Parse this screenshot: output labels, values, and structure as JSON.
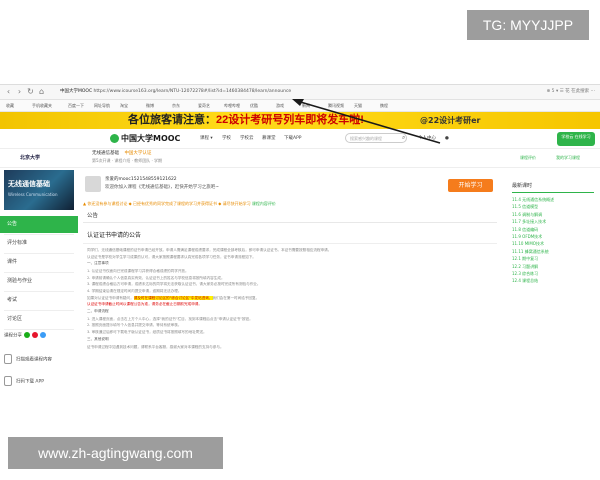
{
  "overlay": {
    "tg_label": "TG: MYYJJPP",
    "site_label": "www.zh-agtingwang.com"
  },
  "browser": {
    "back": "‹",
    "forward": "›",
    "reload": "↻",
    "home": "⌂",
    "url_host": "中国大学MOOC",
    "url": "https://www.icourse163.org/learn/NTU-12072278#/list?id=1460384478/learn/announce",
    "right_tools": "⊕ 5 ▾  ☰ 花  在此搜索  ⋯",
    "bookmarks": [
      "收藏",
      "手机收藏夹",
      "百度一下",
      "网址导航",
      "淘宝",
      "微博",
      "京东",
      "爱奇艺",
      "哔哩哔哩",
      "优酷",
      "游戏",
      "新闻",
      "腾讯视频",
      "天猫",
      "携程"
    ]
  },
  "banner": {
    "prefix": "各位旅客请注意：",
    "highlight": "22设计考研号列车即将发车啦!",
    "right": "@22设计考研er"
  },
  "mooc_header": {
    "logo": "中国大学MOOC",
    "nav": [
      "课程 ▾",
      "学校",
      "学校云",
      "慕课堂",
      "下载APP"
    ],
    "search_placeholder": "搜索感兴趣的课程",
    "search_icon": "search-icon",
    "personal": "个人中心",
    "green_button": "学校云 在线学习"
  },
  "course_header": {
    "school": "北京大学",
    "course_name": "无线通信基础",
    "tag": "中国大学认证",
    "course_sub": "第5次开课  · 课程介绍  · 教师团队  · 学期",
    "right_links": [
      "课程评价",
      "我的学习课程"
    ]
  },
  "sidebar": {
    "thumb_title": "无线通信基础",
    "thumb_sub": "Wireless Communication",
    "items": [
      "公告",
      "评分标准",
      "课件",
      "测验与作业",
      "考试",
      "讨论区"
    ],
    "active_index": 0,
    "share_label": "课程分享",
    "share_colors": [
      "#1aad19",
      "#e6162d",
      "#3b9cf6"
    ],
    "apps": [
      "扫描观看课程内容",
      "扫码下载 APP"
    ]
  },
  "content": {
    "welcome_line1": "亲爱的mooc1521548559121622",
    "welcome_line2": "欢迎你加入课程《无线通信基础》，赶快开始学习之旅吧~",
    "start_button": "开始学习",
    "tips": "▲ 你还没有参与课程讨论  ◆ 已经有优秀的同学完成了课程的学习并获得证书  ◆ 请尽快开始学习  ",
    "tips_ok": "课程内容评价",
    "section_label": "公告",
    "announcement_title": "认证证书申请的公告",
    "paragraphs": [
      {
        "text": "同学们，无线通信基础课程的证书申请已经开放。申请人需满足课程成绩要求，完成课程全部考核后，即可申请认证证书。",
        "tail": "本证书需要按照相应流程申请。",
        "style": "normal"
      },
      {
        "text": "认证证书是学校对学生学习成果的认可，请大家按照课程要求认真完成各项学习任务，证书申请流程如下。",
        "tail": "",
        "style": "normal"
      },
      {
        "text": "一、注意事项",
        "tail": "",
        "style": "dark"
      },
      {
        "text": "1. 认证证书仅面向已完成课程学习并获得合格成绩的同学开放。",
        "tail": "",
        "style": "normal"
      },
      {
        "text": "2. 申请前请确认个人信息真实有效，认证证书上的姓名与学校信息将按所填内容生成。",
        "tail": "",
        "style": "normal"
      },
      {
        "text": "3. 课程成绩合格后方可申请，成绩未达标的同学将无法获取认证证书，请大家务必按时完成所有测验与作业。",
        "tail": "",
        "style": "normal"
      },
      {
        "text": "4. 学期结束后请在规定时间内提交申请，逾期将无法办理。",
        "tail": "",
        "style": "normal"
      },
      {
        "text": "如果对认证证书申请有疑问，",
        "hl": "请及时在课程讨论区的\"综合讨论区\"中发帖咨询，",
        "tail": "我们会在第一时间给予回复。",
        "style": "normal"
      },
      {
        "text": "",
        "red": "认证证书申请截止时间以课程公告为准，请务必在截止日期前完成申请。",
        "tail": "",
        "style": "normal"
      },
      {
        "text": "二、申请流程",
        "tail": "",
        "style": "dark"
      },
      {
        "text": "1. 进入课程页面，点击右上方个人中心，选择\"我的证书\"栏目，找到本课程后点击\"申请认证证书\"按钮。",
        "tail": "",
        "style": "normal"
      },
      {
        "text": "2. 按照页面提示填写个人信息并提交申请，等待系统审核。",
        "tail": "",
        "style": "normal"
      },
      {
        "text": "3. 审核通过后即可下载电子版认证证书，纸质证书将按照填写的地址寄送。",
        "tail": "",
        "style": "normal"
      },
      {
        "text": "三、其他说明",
        "tail": "",
        "style": "dark"
      },
      {
        "text": "证书申请过程中如遇到技术问题，请联系平台客服，感谢大家对本课程的支持与参与。",
        "tail": "",
        "style": "normal"
      }
    ]
  },
  "rightcol": {
    "title": "最新课时",
    "items": [
      "11.4 无线通信系统概述",
      "11.5 信道模型",
      "11.6 调制与解调",
      "11.7 多址接入技术",
      "11.8 信道编码",
      "11.9 OFDM技术",
      "11.10 MIMO技术",
      "11.11 蜂窝通信系统",
      "12.1 期中复习",
      "12.2 习题讲解",
      "12.3 综合练习",
      "12.4 课程总结"
    ]
  }
}
